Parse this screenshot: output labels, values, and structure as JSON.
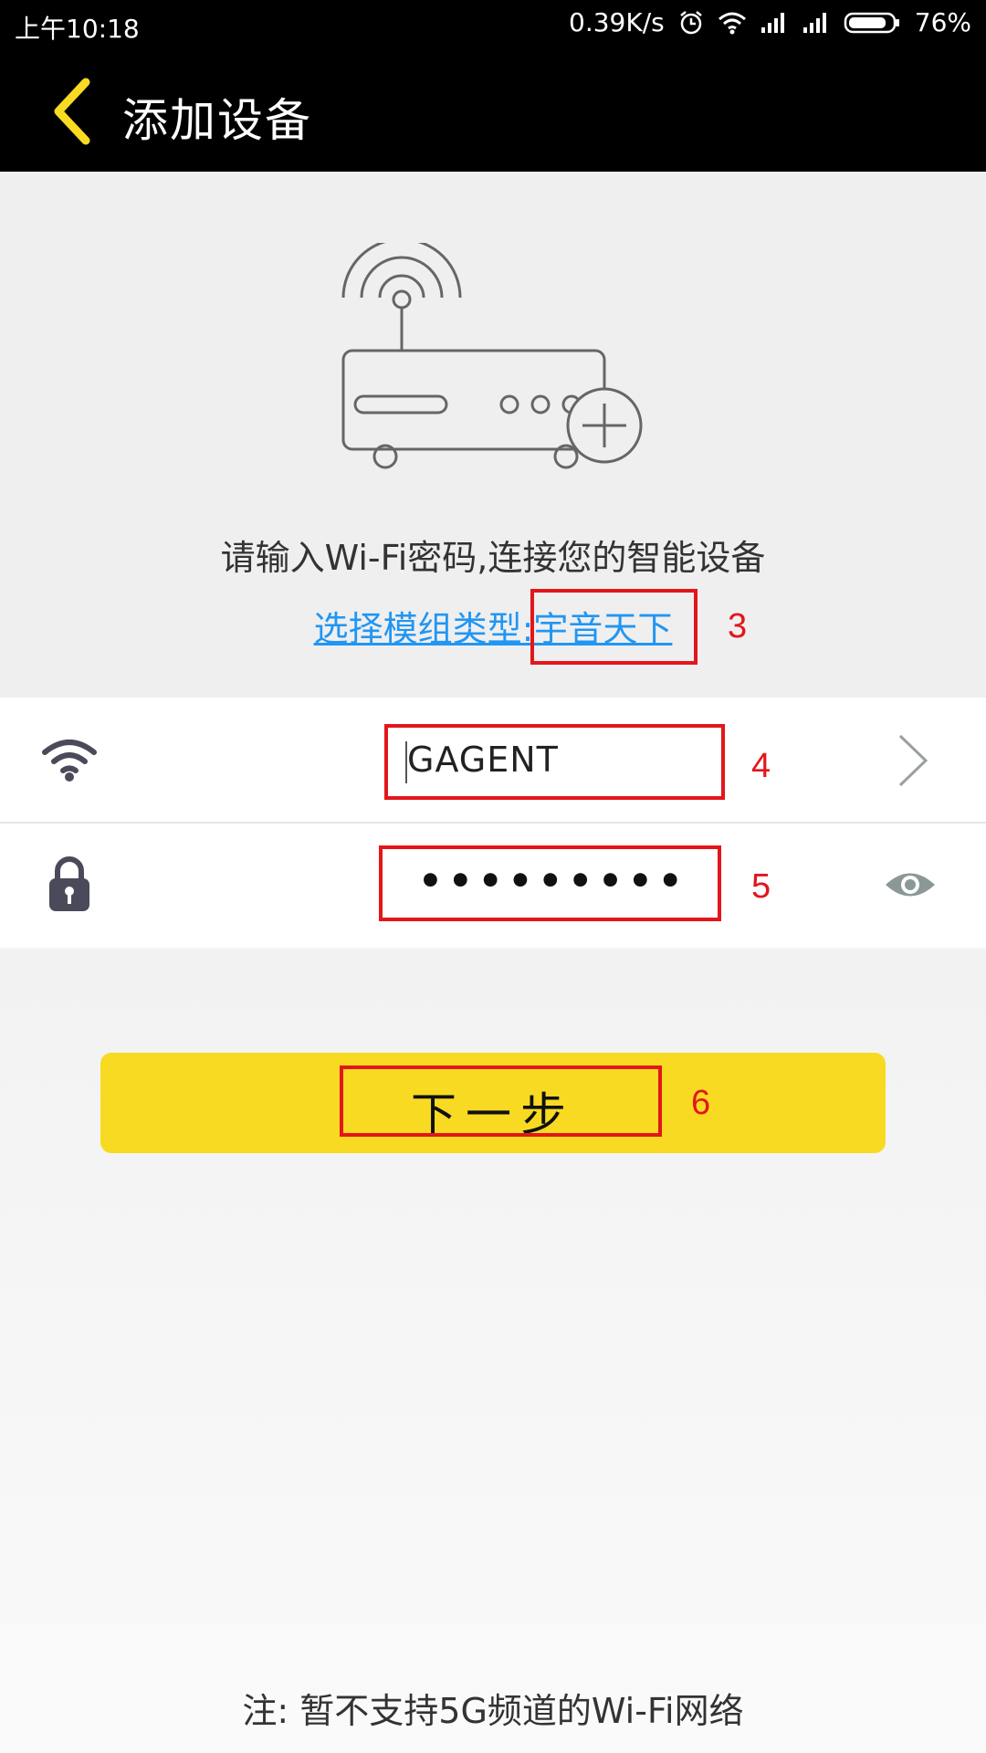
{
  "status_bar": {
    "time": "上午10:18",
    "network_speed": "0.39K/s",
    "battery": "76%"
  },
  "toolbar": {
    "back_icon": "chevron-left-icon",
    "title": "添加设备"
  },
  "hero": {
    "illustration": "router-add-icon",
    "hint": "请输入Wi-Fi密码,连接您的智能设备",
    "module_link": "选择模组类型:宇音天下"
  },
  "wifi_row": {
    "icon": "wifi-icon",
    "ssid": "GAGENT",
    "action_icon": "chevron-right-icon"
  },
  "password_row": {
    "icon": "lock-icon",
    "password": "•••••••••",
    "action_icon": "eye-icon"
  },
  "next_button": {
    "label": "下一步"
  },
  "annotations": [
    "3",
    "4",
    "5",
    "6"
  ],
  "footer": {
    "note": "注: 暂不支持5G频道的Wi-Fi网络"
  },
  "colors": {
    "accent_yellow": "#f8da22",
    "link_blue": "#2196f3",
    "annotation_red": "#e3161b"
  }
}
